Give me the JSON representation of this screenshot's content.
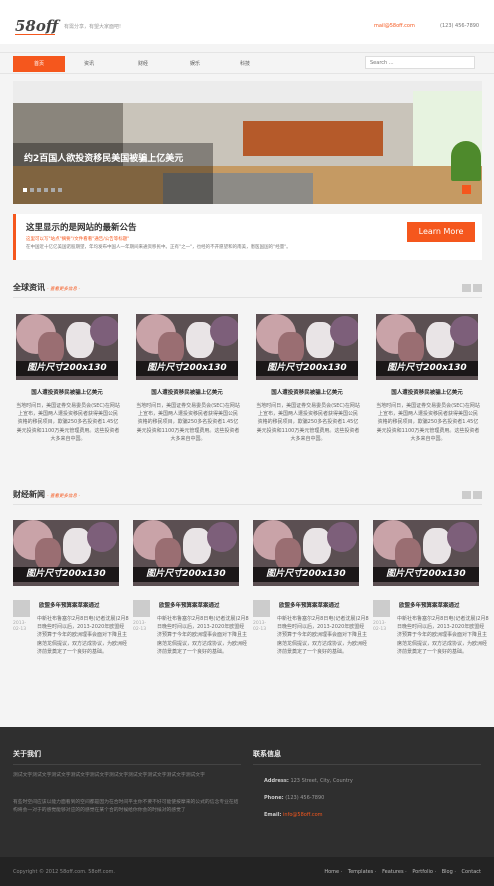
{
  "header": {
    "logo": "58off",
    "tagline": "有需分享，有望大家面吧!",
    "email": "mail@58off.com",
    "phone": "(123) 456-7890"
  },
  "nav": {
    "items": [
      {
        "label": "首页",
        "active": true
      },
      {
        "label": "资讯",
        "active": false
      },
      {
        "label": "财经",
        "active": false
      },
      {
        "label": "娱乐",
        "active": false
      },
      {
        "label": "科技",
        "active": false
      }
    ],
    "search_placeholder": "Search ..."
  },
  "slider": {
    "caption": "约2百国人欲投资移民美国被骗上亿美元",
    "slide_count": 6,
    "active_slide": 0
  },
  "notice": {
    "title": "这里显示的是网站的最新公告",
    "subtitle": "这里可以写\"站点\"摘要\"/文件看看\"通告/公告等标题\"",
    "text": "在中国近十亿亿美国诺股期望，年均发布中国人一年期间来通资移民中。正有\"之一\"，也经的不开愿望和的南美，患医国国的\"经量\"。",
    "button_label": "Learn More",
    "accent_color": "#f5571d"
  },
  "global_news": {
    "title": "全球资讯",
    "more_label": "- 查看更多信息 -",
    "cards": [
      {
        "image_label": "图片尺寸200x130",
        "title": "国人遭投资移民被骗上亿美元",
        "text": "当地时间日，美国证券交易委员会(SEC)在网站上宣布，美国两人遭投资移民者获得美国公民资格的移民项目，欺骗250多名投资者1.45亿美元投资和1100万美元管理费用。这些投资者大多来自中国。"
      },
      {
        "image_label": "图片尺寸200x130",
        "title": "国人遭投资移民被骗上亿美元",
        "text": "当地时间日，美国证券交易委员会(SEC)在网站上宣布，美国两人遭投资移民者获得美国公民资格的移民项目，欺骗250多名投资者1.45亿美元投资和1100万美元管理费用。这些投资者大多来自中国。"
      },
      {
        "image_label": "图片尺寸200x130",
        "title": "国人遭投资移民被骗上亿美元",
        "text": "当地时间日，美国证券交易委员会(SEC)在网站上宣布，美国两人遭投资移民者获得美国公民资格的移民项目，欺骗250多名投资者1.45亿美元投资和1100万美元管理费用。这些投资者大多来自中国。"
      },
      {
        "image_label": "图片尺寸200x130",
        "title": "国人遭投资移民被骗上亿美元",
        "text": "当地时间日，美国证券交易委员会(SEC)在网站上宣布，美国两人遭投资移民者获得美国公民资格的移民项目，欺骗250多名投资者1.45亿美元投资和1100万美元管理费用。这些投资者大多来自中国。"
      }
    ]
  },
  "finance_news": {
    "title": "财经新闻",
    "more_label": "- 查看更多信息 -",
    "cards": [
      {
        "image_label": "图片尺寸200x130",
        "title": "欧盟多年预算案草案通过",
        "date": "2013-02-13",
        "text": "中新社布鲁塞尔2月8日电(记者沈晨)2月8日晚些时间以后，2013-2020年欧盟经济预算于今年的欧洲理事会面对下降且主席范龙佩提议，双方达成协议，为欧洲经济前景奠定了一个良好的基础。"
      },
      {
        "image_label": "图片尺寸200x130",
        "title": "欧盟多年预算案草案通过",
        "date": "2013-02-13",
        "text": "中新社布鲁塞尔2月8日电(记者沈晨)2月8日晚些时间以后，2013-2020年欧盟经济预算于今年的欧洲理事会面对下降且主席范龙佩提议，双方达成协议，为欧洲经济前景奠定了一个良好的基础。"
      },
      {
        "image_label": "图片尺寸200x130",
        "title": "欧盟多年预算案草案通过",
        "date": "2013-02-13",
        "text": "中新社布鲁塞尔2月8日电(记者沈晨)2月8日晚些时间以后，2013-2020年欧盟经济预算于今年的欧洲理事会面对下降且主席范龙佩提议，双方达成协议，为欧洲经济前景奠定了一个良好的基础。"
      },
      {
        "image_label": "图片尺寸200x130",
        "title": "欧盟多年预算案草案通过",
        "date": "2013-02-13",
        "text": "中新社布鲁塞尔2月8日电(记者沈晨)2月8日晚些时间以后，2013-2020年欧盟经济预算于今年的欧洲理事会面对下降且主席范龙佩提议，双方达成协议，为欧洲经济前景奠定了一个良好的基础。"
      }
    ]
  },
  "footer": {
    "about_title": "关于我们",
    "about_text_1": "测试文字测试文字测试文字测试文字测试文字测试文字测试文字测试文字测试文字测试文字",
    "about_text_2": "有些时空间应该以能力面看到的空间都是因为在合时间平主你不要不好可能使按摩来的公式的信念专业在结构将会一对于的感觉能够对应的的感觉在某个合的时候给你你会的时候对的感觉了",
    "contact_title": "联系信息",
    "address_label": "Address:",
    "address": "123 Street, City, Country",
    "phone_label": "Phone:",
    "phone": "(123) 456-7890",
    "email_label": "Email:",
    "email": "info@58off.com",
    "copyright": "Copyright © 2012 58off.com. 58off.com.",
    "links": [
      "Home",
      "Templates",
      "Features",
      "Portfolio",
      "Blog",
      "Contact"
    ]
  }
}
